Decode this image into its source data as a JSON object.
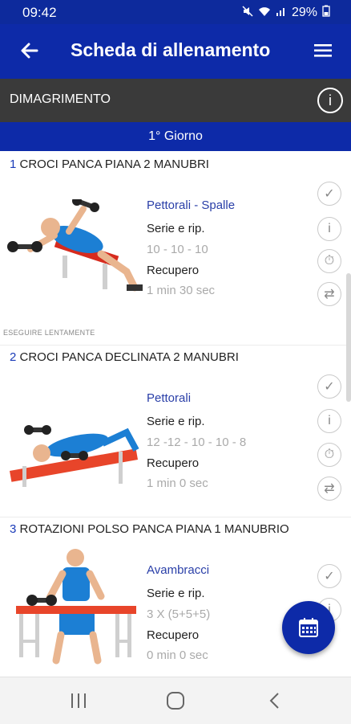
{
  "status": {
    "time": "09:42",
    "battery": "29%"
  },
  "appbar": {
    "title": "Scheda di allenamento"
  },
  "program": {
    "name": "DIMAGRIMENTO"
  },
  "day": {
    "label": "1° Giorno"
  },
  "labels": {
    "sets": "Serie e rip.",
    "rest": "Recupero"
  },
  "exercises": [
    {
      "number": "1",
      "name": "CROCI PANCA PIANA 2 MANUBRI",
      "muscles": "Pettorali - Spalle",
      "reps": "10 - 10 - 10",
      "rest": "1 min 30 sec",
      "note": "ESEGUIRE LENTAMENTE"
    },
    {
      "number": "2",
      "name": "CROCI PANCA DECLINATA 2 MANUBRI",
      "muscles": "Pettorali",
      "reps": "12 -12 - 10 - 10 - 8",
      "rest": "1 min 0 sec"
    },
    {
      "number": "3",
      "name": "ROTAZIONI POLSO PANCA PIANA 1 MANUBRIO",
      "muscles": "Avambracci",
      "reps": "3 X (5+5+5)",
      "rest": "0 min 0 sec"
    }
  ],
  "icons": [
    "check-icon",
    "info-icon",
    "timer-icon",
    "swap-icon",
    "calendar-icon",
    "back-arrow-icon",
    "menu-icon"
  ],
  "colors": {
    "primary": "#0d2aa8",
    "header_dark": "#3a3a3a",
    "muscle_text": "#2a3fa8"
  }
}
